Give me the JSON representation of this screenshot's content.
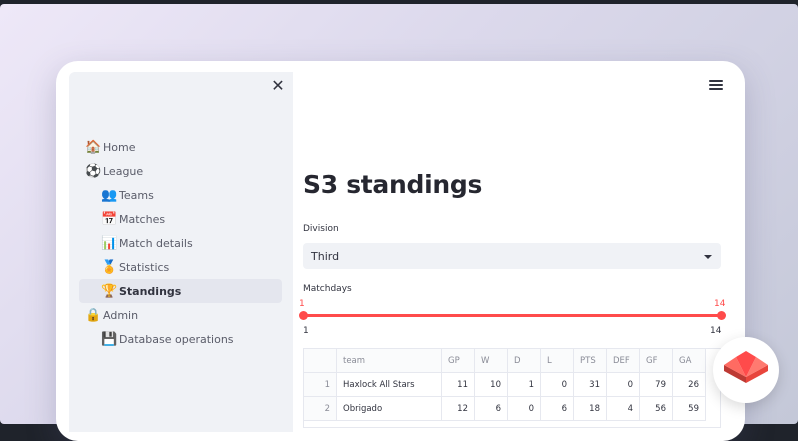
{
  "sidebar": {
    "close_glyph": "✕",
    "items": [
      {
        "emoji": "🏠",
        "label": "Home"
      },
      {
        "emoji": "⚽",
        "label": "League"
      },
      {
        "emoji": "👥",
        "label": "Teams"
      },
      {
        "emoji": "📅",
        "label": "Matches"
      },
      {
        "emoji": "📊",
        "label": "Match details"
      },
      {
        "emoji": "🏅",
        "label": "Statistics"
      },
      {
        "emoji": "🏆",
        "label": "Standings"
      },
      {
        "emoji": "🔒",
        "label": "Admin"
      },
      {
        "emoji": "💾",
        "label": "Database operations"
      }
    ]
  },
  "main": {
    "title": "S3 standings",
    "division": {
      "label": "Division",
      "value": "Third"
    },
    "matchdays": {
      "label": "Matchdays",
      "min": "1",
      "max": "14",
      "low": "1",
      "high": "14"
    },
    "table": {
      "headers": [
        "",
        "team",
        "GP",
        "W",
        "D",
        "L",
        "PTS",
        "DEF",
        "GF",
        "GA"
      ],
      "rows": [
        [
          "1",
          "Haxlock All Stars",
          "11",
          "10",
          "1",
          "0",
          "31",
          "0",
          "79",
          "26"
        ],
        [
          "2",
          "Obrigado",
          "12",
          "6",
          "0",
          "6",
          "18",
          "4",
          "56",
          "59"
        ]
      ]
    }
  },
  "colors": {
    "accent": "#ff4b4b",
    "sidebar_bg": "#f0f2f6",
    "logo_red": "#e8453c"
  },
  "icons": {
    "close": "close-icon",
    "menu": "hamburger-menu-icon",
    "logo": "streamlit-logo-icon",
    "caret": "chevron-down-icon"
  }
}
